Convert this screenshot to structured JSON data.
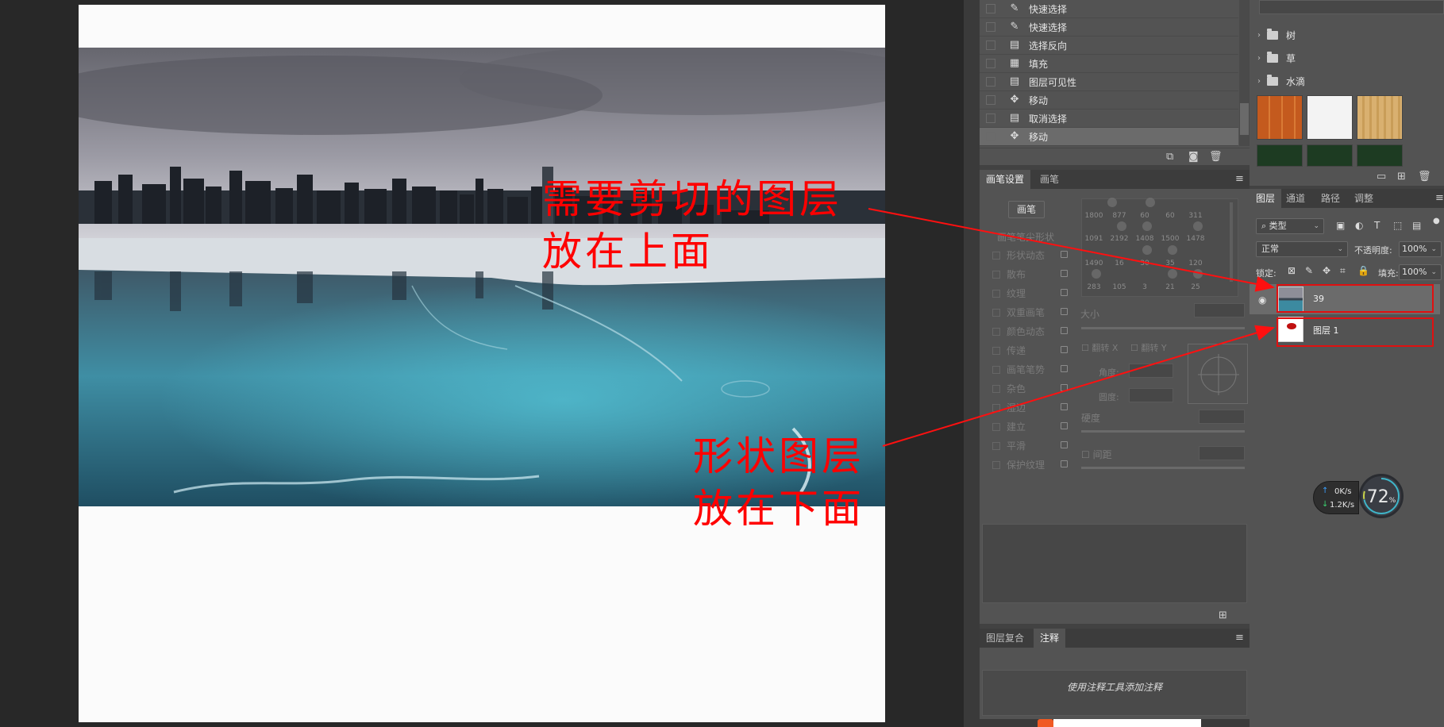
{
  "annotations": {
    "top_line1": "需要剪切的图层",
    "top_line2": "放在上面",
    "bottom_line1": "形状图层",
    "bottom_line2": "放在下面"
  },
  "history": {
    "items": [
      {
        "label": "快速选择",
        "icon": "quick-select-icon"
      },
      {
        "label": "快速选择",
        "icon": "quick-select-icon"
      },
      {
        "label": "选择反向",
        "icon": "document-icon"
      },
      {
        "label": "填充",
        "icon": "fill-icon"
      },
      {
        "label": "图层可见性",
        "icon": "document-icon"
      },
      {
        "label": "移动",
        "icon": "move-icon"
      },
      {
        "label": "取消选择",
        "icon": "document-icon"
      },
      {
        "label": "移动",
        "icon": "move-icon",
        "selected": true
      }
    ]
  },
  "brush_panel": {
    "tab_settings": "画笔设置",
    "tab_brush": "画笔",
    "brush_button": "画笔",
    "tip_shape": "画笔笔尖形状",
    "options": [
      "形状动态",
      "散布",
      "纹理",
      "双重画笔",
      "颜色动态",
      "传递",
      "画笔笔势",
      "杂色",
      "湿边",
      "建立",
      "平滑",
      "保护纹理"
    ],
    "brush_sizes": [
      "1800",
      "877",
      "60",
      "60",
      "311",
      "1091",
      "2192",
      "1408",
      "1500",
      "1478",
      "1490",
      "16",
      "30",
      "35",
      "120",
      "283",
      "105",
      "3",
      "21",
      "25"
    ],
    "size_label": "大小",
    "flip_x": "翻转 X",
    "flip_y": "翻转 Y",
    "angle_label": "角度:",
    "roundness_label": "圆度:",
    "hardness_label": "硬度",
    "spacing_label": "间距"
  },
  "notes_panel": {
    "tab_comps": "图层复合",
    "tab_notes": "注释",
    "hint": "使用注释工具添加注释"
  },
  "library": {
    "folders": [
      "树",
      "草",
      "水滴"
    ]
  },
  "layers_panel": {
    "tab_layers": "图层",
    "tab_channels": "通道",
    "tab_paths": "路径",
    "tab_adjust": "调整",
    "filter_type": "类型",
    "blend_mode": "正常",
    "opacity_label": "不透明度:",
    "opacity_value": "100%",
    "lock_label": "锁定:",
    "fill_label": "填充:",
    "fill_value": "100%",
    "layers": [
      {
        "name": "39",
        "selected": true
      },
      {
        "name": "图层 1",
        "selected": false
      }
    ]
  },
  "widget": {
    "up_speed": "0K/s",
    "down_speed": "1.2K/s",
    "percent": "72",
    "percent_unit": "%"
  }
}
